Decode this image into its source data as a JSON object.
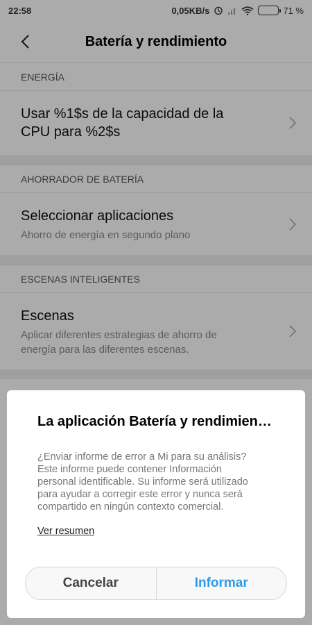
{
  "status_bar": {
    "time": "22:58",
    "net_speed": "0,05KB/s",
    "battery": "71 %"
  },
  "header": {
    "title": "Batería y rendimiento"
  },
  "sections": {
    "energy": {
      "header": "ENERGÍA",
      "item_title_line1": "Usar %1$s de la capacidad de la",
      "item_title_line2": "CPU para %2$s"
    },
    "saver": {
      "header": "AHORRADOR DE BATERÍA",
      "item_title": "Seleccionar aplicaciones",
      "item_subtitle": "Ahorro de energía en segundo plano"
    },
    "scenes": {
      "header": "ESCENAS INTELIGENTES",
      "item_title": "Escenas",
      "item_subtitle_line1": "Aplicar diferentes estrategias de ahorro de",
      "item_subtitle_line2": "energía para las diferentes escenas."
    }
  },
  "dialog": {
    "title": "La aplicación Batería y rendimien…",
    "message_line1": "¿Enviar informe de error a Mi para su análisis?",
    "message_line2": "Este informe puede contener Información",
    "message_line3": "personal identificable. Su informe será utilizado",
    "message_line4": "para ayudar a corregir este error y nunca será",
    "message_line5": "compartido en ningún contexto comercial.",
    "link": "Ver resumen",
    "cancel": "Cancelar",
    "report": "Informar"
  },
  "colors": {
    "accent": "#2c9ae8",
    "overlay": "rgba(0,0,0,0.33)"
  }
}
